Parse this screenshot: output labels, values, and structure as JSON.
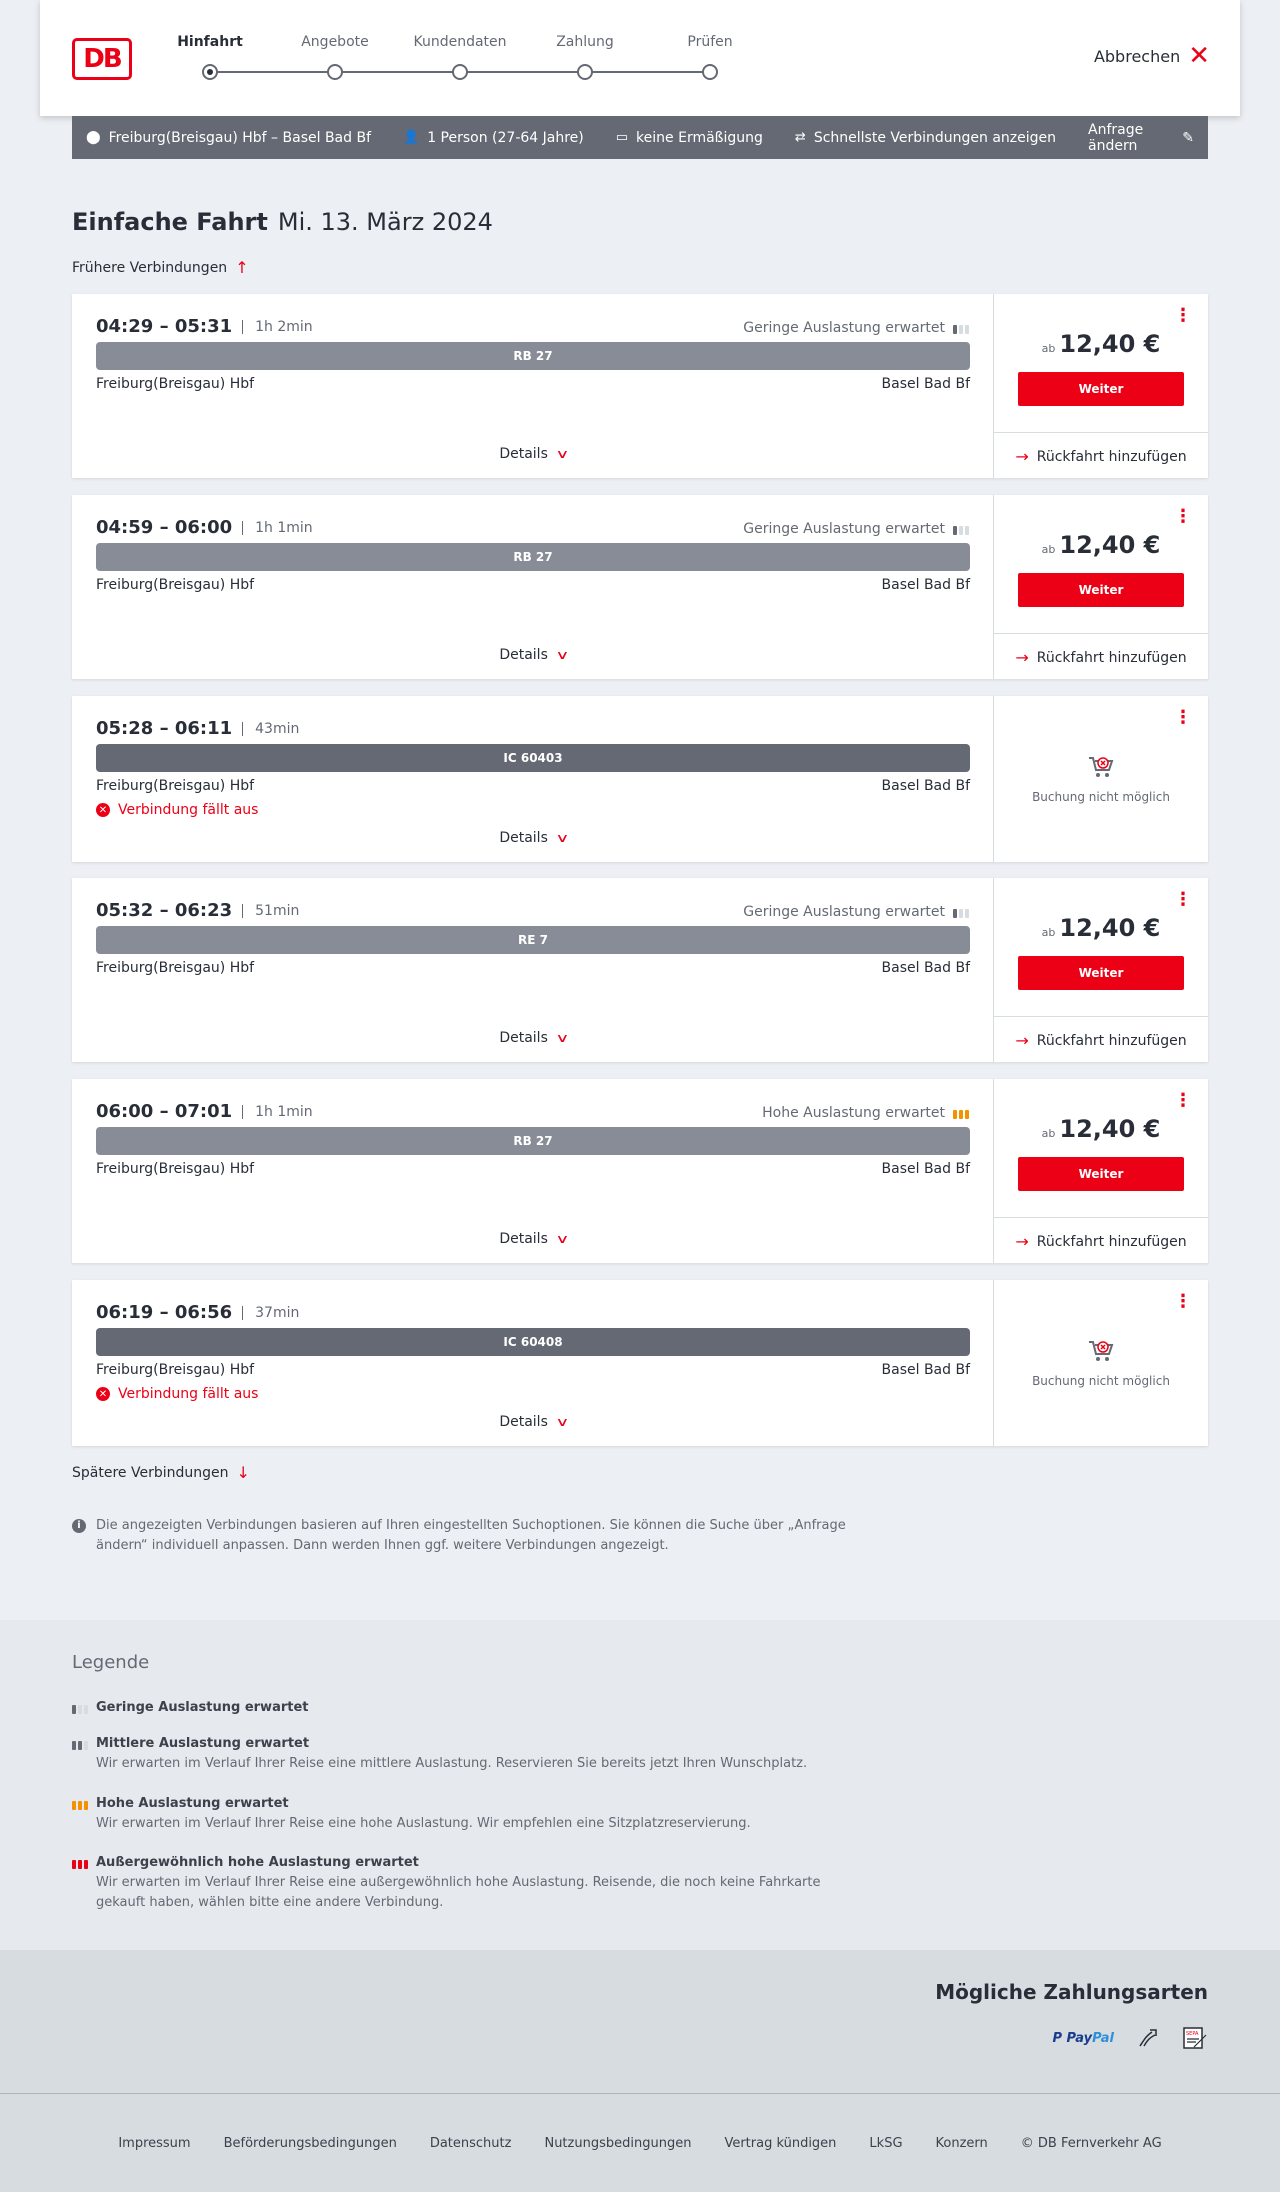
{
  "header": {
    "logo_text": "DB",
    "steps": [
      "Hinfahrt",
      "Angebote",
      "Kundendaten",
      "Zahlung",
      "Prüfen"
    ],
    "active_step": 0,
    "cancel_label": "Abbrechen"
  },
  "query": {
    "route": "Freiburg(Breisgau) Hbf – Basel Bad Bf",
    "passengers": "1 Person (27-64 Jahre)",
    "discount": "keine Ermäßigung",
    "fastest": "Schnellste Verbindungen anzeigen",
    "change_label": "Anfrage ändern"
  },
  "title": {
    "type": "Einfache Fahrt",
    "date": "Mi. 13. März 2024"
  },
  "earlier_label": "Frühere Verbindungen",
  "later_label": "Spätere Verbindungen",
  "connections": [
    {
      "times": "04:29 – 05:31",
      "duration": "1h 2min",
      "occupancy": "Geringe Auslastung erwartet",
      "occupancy_level": "low",
      "train": "RB 27",
      "from": "Freiburg(Breisgau) Hbf",
      "to": "Basel Bad Bf",
      "cancelled": "",
      "price_prefix": "ab",
      "price": "12,40 €",
      "button": "Weiter",
      "return_label": "Rückfahrt hinzufügen",
      "details": "Details"
    },
    {
      "times": "04:59 – 06:00",
      "duration": "1h 1min",
      "occupancy": "Geringe Auslastung erwartet",
      "occupancy_level": "low",
      "train": "RB 27",
      "from": "Freiburg(Breisgau) Hbf",
      "to": "Basel Bad Bf",
      "cancelled": "",
      "price_prefix": "ab",
      "price": "12,40 €",
      "button": "Weiter",
      "return_label": "Rückfahrt hinzufügen",
      "details": "Details"
    },
    {
      "times": "05:28 – 06:11",
      "duration": "43min",
      "occupancy": "",
      "occupancy_level": "",
      "train": "IC 60403",
      "from": "Freiburg(Breisgau) Hbf",
      "to": "Basel Bad Bf",
      "cancelled": "Verbindung fällt aus",
      "booking_unavailable": "Buchung nicht möglich",
      "details": "Details"
    },
    {
      "times": "05:32 – 06:23",
      "duration": "51min",
      "occupancy": "Geringe Auslastung erwartet",
      "occupancy_level": "low",
      "train": "RE 7",
      "from": "Freiburg(Breisgau) Hbf",
      "to": "Basel Bad Bf",
      "cancelled": "",
      "price_prefix": "ab",
      "price": "12,40 €",
      "button": "Weiter",
      "return_label": "Rückfahrt hinzufügen",
      "details": "Details"
    },
    {
      "times": "06:00 – 07:01",
      "duration": "1h 1min",
      "occupancy": "Hohe Auslastung erwartet",
      "occupancy_level": "high",
      "train": "RB 27",
      "from": "Freiburg(Breisgau) Hbf",
      "to": "Basel Bad Bf",
      "cancelled": "",
      "price_prefix": "ab",
      "price": "12,40 €",
      "button": "Weiter",
      "return_label": "Rückfahrt hinzufügen",
      "details": "Details"
    },
    {
      "times": "06:19 – 06:56",
      "duration": "37min",
      "occupancy": "",
      "occupancy_level": "",
      "train": "IC 60408",
      "from": "Freiburg(Breisgau) Hbf",
      "to": "Basel Bad Bf",
      "cancelled": "Verbindung fällt aus",
      "booking_unavailable": "Buchung nicht möglich",
      "details": "Details"
    }
  ],
  "info_note": "Die angezeigten Verbindungen basieren auf Ihren eingestellten Suchoptionen. Sie können die Suche über „Anfrage ändern“ individuell anpassen. Dann werden Ihnen ggf. weitere Verbindungen angezeigt.",
  "legend": {
    "title": "Legende",
    "items": [
      {
        "title": "Geringe Auslastung erwartet",
        "desc": "",
        "level": "low"
      },
      {
        "title": "Mittlere Auslastung erwartet",
        "desc": "Wir erwarten im Verlauf Ihrer Reise eine mittlere Auslastung. Reservieren Sie bereits jetzt Ihren Wunschplatz.",
        "level": "mid"
      },
      {
        "title": "Hohe Auslastung erwartet",
        "desc": "Wir erwarten im Verlauf Ihrer Reise eine hohe Auslastung. Wir empfehlen eine Sitzplatzreservierung.",
        "level": "high"
      },
      {
        "title": "Außergewöhnlich hohe Auslastung erwartet",
        "desc": "Wir erwarten im Verlauf Ihrer Reise eine außergewöhnlich hohe Auslastung. Reisende, die noch keine Fahrkarte gekauft haben, wählen bitte eine andere Verbindung.",
        "level": "extreme"
      }
    ]
  },
  "payment": {
    "title": "Mögliche Zahlungsarten",
    "paypal_a": "Pay",
    "paypal_b": "Pal",
    "sepa": "SEPA"
  },
  "footer": [
    "Impressum",
    "Beförderungsbedingungen",
    "Datenschutz",
    "Nutzungsbedingungen",
    "Vertrag kündigen",
    "LkSG",
    "Konzern",
    "© DB Fernverkehr AG"
  ]
}
